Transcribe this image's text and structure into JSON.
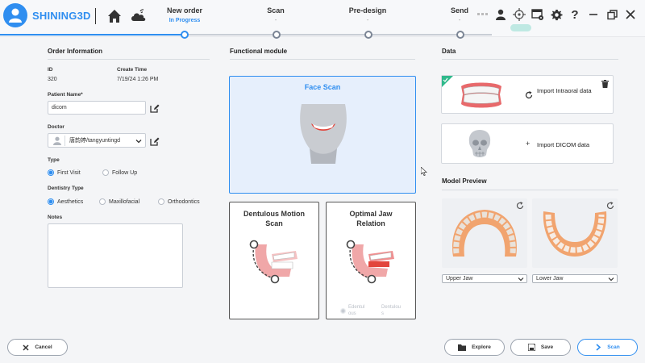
{
  "app": {
    "brand": "SHINING3D"
  },
  "steps": [
    {
      "title": "New order",
      "sub": "In Progress"
    },
    {
      "title": "Scan",
      "sub": "-"
    },
    {
      "title": "Pre-design",
      "sub": "-"
    },
    {
      "title": "Send",
      "sub": "-"
    }
  ],
  "order_info": {
    "title": "Order Information",
    "id_label": "ID",
    "id_value": "320",
    "create_time_label": "Create Time",
    "create_time_value": "7/19/24 1:26 PM",
    "patient_label": "Patient Name*",
    "patient_value": "dicom",
    "doctor_label": "Doctor",
    "doctor_value": "唐韵婷/tangyuntingd",
    "type_label": "Type",
    "type_options": [
      "First Visit",
      "Follow Up"
    ],
    "type_selected": "First Visit",
    "dentistry_label": "Dentistry Type",
    "dentistry_options": [
      "Aesthetics",
      "Maxillofacial",
      "Orthodontics"
    ],
    "dentistry_selected": "Aesthetics",
    "notes_label": "Notes"
  },
  "functional": {
    "title": "Functional module",
    "face_scan": "Face Scan",
    "dentulous_motion": "Dentulous Motion Scan",
    "optimal_jaw": "Optimal Jaw Relation",
    "optimal_opt1": "Edentul ous",
    "optimal_opt2": "Dentulou s"
  },
  "data": {
    "title": "Data",
    "intraoral": "Import Intraoral data",
    "dicom": "Import DICOM data",
    "preview_title": "Model Preview",
    "upper_select": "Upper Jaw",
    "lower_select": "Lower Jaw"
  },
  "footer": {
    "cancel": "Cancel",
    "explore": "Explore",
    "save": "Save",
    "scan": "Scan"
  },
  "colors": {
    "accent": "#2f8ef0",
    "card_selected": "#e6effc",
    "badge": "#2fb98b"
  }
}
